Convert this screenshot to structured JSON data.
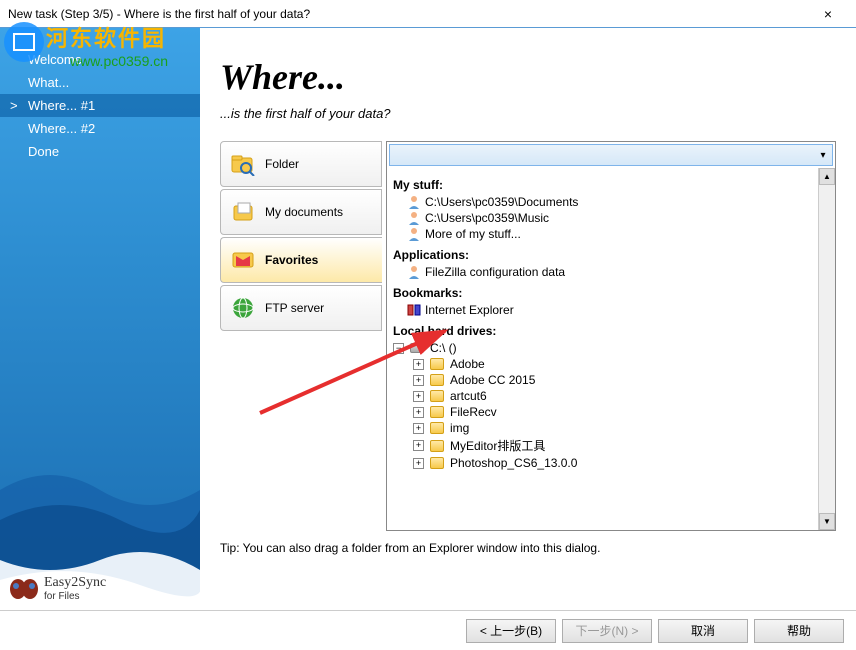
{
  "window": {
    "title": "New task (Step 3/5) - Where is the first half of your data?",
    "close": "×"
  },
  "sidebar": {
    "items": [
      {
        "label": "Welcome"
      },
      {
        "label": "What..."
      },
      {
        "label": "Where... #1"
      },
      {
        "label": "Where... #2"
      },
      {
        "label": "Done"
      }
    ],
    "selected_index": 2
  },
  "logo": {
    "name": "Easy2Sync",
    "sub": "for Files"
  },
  "content": {
    "heading": "Where...",
    "subheading": "...is the first half of your data?",
    "tabs": [
      {
        "id": "folder",
        "label": "Folder"
      },
      {
        "id": "mydocs",
        "label": "My documents"
      },
      {
        "id": "favorites",
        "label": "Favorites"
      },
      {
        "id": "ftp",
        "label": "FTP server"
      }
    ],
    "selected_tab": 2,
    "combo_value": "",
    "sections": {
      "my_stuff": {
        "title": "My stuff:",
        "items": [
          "C:\\Users\\pc0359\\Documents",
          "C:\\Users\\pc0359\\Music",
          "More of my stuff..."
        ]
      },
      "applications": {
        "title": "Applications:",
        "items": [
          "FileZilla configuration data"
        ]
      },
      "bookmarks": {
        "title": "Bookmarks:",
        "items": [
          "Internet Explorer"
        ]
      },
      "drives": {
        "title": "Local hard drives:",
        "root": "C:\\ ()",
        "folders": [
          "Adobe",
          "Adobe CC 2015",
          "artcut6",
          "FileRecv",
          "img",
          "MyEditor排版工具",
          "Photoshop_CS6_13.0.0"
        ]
      }
    },
    "tip": "Tip: You can also drag a folder from an Explorer window into this dialog."
  },
  "footer": {
    "back": "< 上一步(B)",
    "next": "下一步(N) >",
    "cancel": "取消",
    "help": "帮助"
  },
  "watermark": {
    "text": "河东软件园",
    "url": "www.pc0359.cn"
  }
}
